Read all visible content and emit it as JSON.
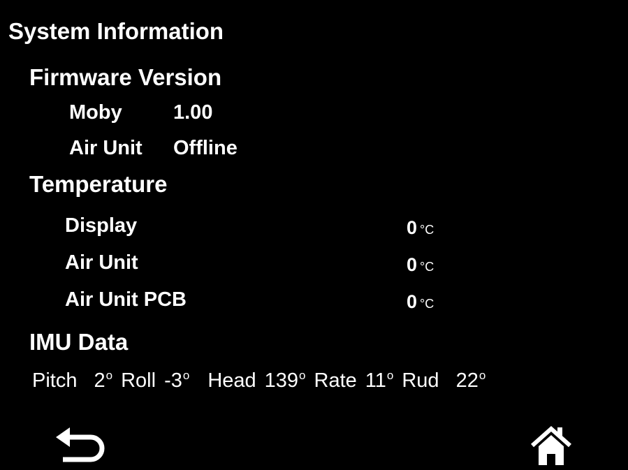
{
  "screen": {
    "title": "System Information"
  },
  "firmware": {
    "heading": "Firmware Version",
    "items": [
      {
        "label": "Moby",
        "value": "1.00"
      },
      {
        "label": "Air Unit",
        "value": "Offline"
      }
    ]
  },
  "temperature": {
    "heading": "Temperature",
    "unit": "°C",
    "items": [
      {
        "label": "Display",
        "value": "0"
      },
      {
        "label": "Air Unit",
        "value": "0"
      },
      {
        "label": "Air Unit PCB",
        "value": "0"
      }
    ]
  },
  "imu": {
    "heading": "IMU Data",
    "deg_symbol": "o",
    "items": [
      {
        "label": "Pitch",
        "value": "2"
      },
      {
        "label": "Roll",
        "value": "-3"
      },
      {
        "label": "Head",
        "value": "139"
      },
      {
        "label": "Rate",
        "value": "11"
      },
      {
        "label": "Rud",
        "value": "22"
      }
    ]
  },
  "nav": {
    "back_icon": "back-arrow-icon",
    "home_icon": "home-icon"
  },
  "colors": {
    "background": "#000000",
    "foreground": "#ffffff"
  }
}
